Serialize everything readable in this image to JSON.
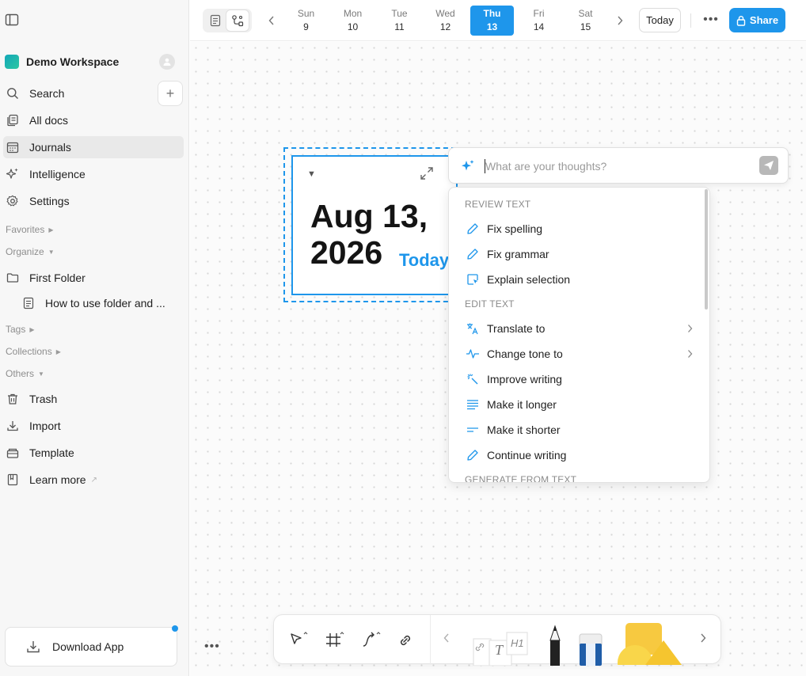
{
  "sidebar": {
    "workspace_name": "Demo Workspace",
    "nav": [
      {
        "label": "Search",
        "icon": "search-icon"
      },
      {
        "label": "All docs",
        "icon": "docs-icon"
      },
      {
        "label": "Journals",
        "icon": "calendar-icon",
        "active": true
      },
      {
        "label": "Intelligence",
        "icon": "sparkle-icon"
      },
      {
        "label": "Settings",
        "icon": "gear-icon"
      }
    ],
    "sections": {
      "favorites": "Favorites",
      "organize": "Organize",
      "tags": "Tags",
      "collections": "Collections",
      "others": "Others"
    },
    "folder": "First Folder",
    "folder_doc": "How to use folder and ...",
    "others_items": [
      {
        "label": "Trash",
        "icon": "trash-icon"
      },
      {
        "label": "Import",
        "icon": "download-icon"
      },
      {
        "label": "Template",
        "icon": "template-icon"
      },
      {
        "label": "Learn more",
        "icon": "book-icon"
      }
    ],
    "download_app": "Download App"
  },
  "topbar": {
    "days": [
      {
        "name": "Sun",
        "date": "9"
      },
      {
        "name": "Mon",
        "date": "10"
      },
      {
        "name": "Tue",
        "date": "11"
      },
      {
        "name": "Wed",
        "date": "12"
      },
      {
        "name": "Thu",
        "date": "13",
        "selected": true
      },
      {
        "name": "Fri",
        "date": "14"
      },
      {
        "name": "Sat",
        "date": "15"
      }
    ],
    "today_label": "Today",
    "share_label": "Share",
    "more_label": "•••"
  },
  "note": {
    "date_line1": "Aug 13,",
    "date_line2": "2026",
    "today_tag": "Today"
  },
  "ai": {
    "placeholder": "What are your thoughts?",
    "sections": {
      "review": "REVIEW TEXT",
      "edit": "EDIT TEXT",
      "generate": "GENERATE FROM TEXT"
    },
    "review_items": [
      "Fix spelling",
      "Fix grammar",
      "Explain selection"
    ],
    "edit_items": [
      "Translate to",
      "Change tone to",
      "Improve writing",
      "Make it longer",
      "Make it shorter",
      "Continue writing"
    ]
  },
  "toolbar": {
    "more_label": "•••"
  },
  "colors": {
    "accent": "#1e96eb",
    "sidebar_bg": "#f7f7f7"
  }
}
